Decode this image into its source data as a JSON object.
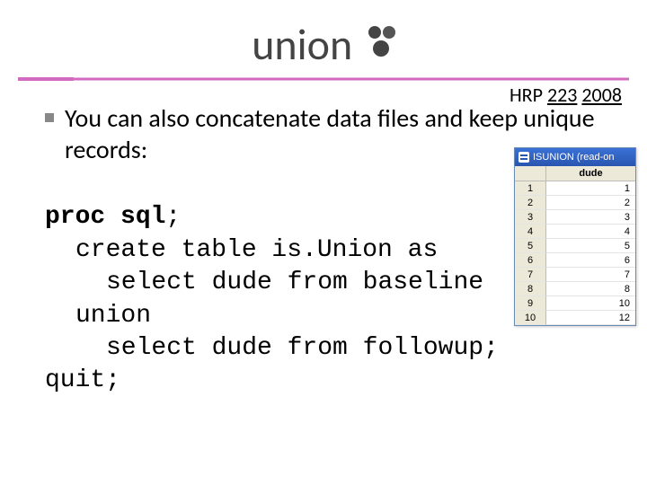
{
  "title": "union",
  "course": {
    "label": "HRP",
    "num": "223",
    "year": "2008"
  },
  "bullet_text": "You can also concatenate data files and keep unique records:",
  "code": {
    "l1a": "proc sql",
    "l1b": ";",
    "l2": "create table is.Union as",
    "l3": "select dude from baseline",
    "l4": "union",
    "l5": "select dude from followup;",
    "l6": "quit;"
  },
  "tablewin": {
    "title": "ISUNION (read-on",
    "col": "dude",
    "rows": [
      {
        "n": "1",
        "v": "1"
      },
      {
        "n": "2",
        "v": "2"
      },
      {
        "n": "3",
        "v": "3"
      },
      {
        "n": "4",
        "v": "4"
      },
      {
        "n": "5",
        "v": "5"
      },
      {
        "n": "6",
        "v": "6"
      },
      {
        "n": "7",
        "v": "7"
      },
      {
        "n": "8",
        "v": "8"
      },
      {
        "n": "9",
        "v": "10"
      },
      {
        "n": "10",
        "v": "12"
      }
    ]
  }
}
